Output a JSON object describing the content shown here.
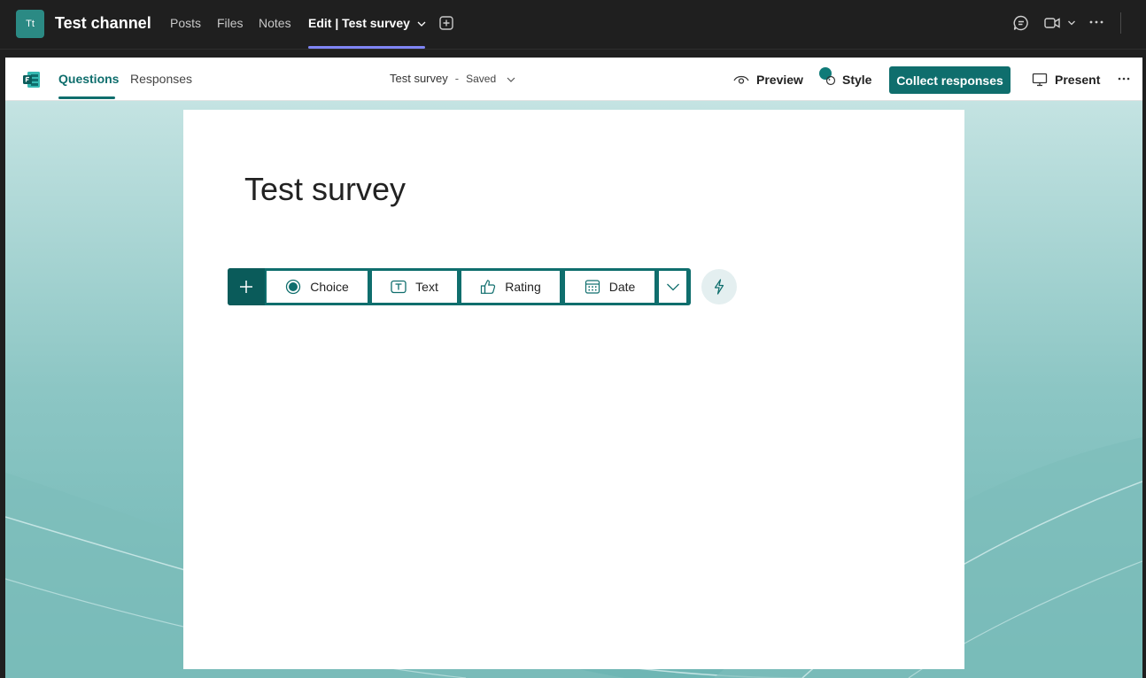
{
  "teams": {
    "avatar_text": "Tt",
    "channel_name": "Test channel",
    "tabs": [
      {
        "label": "Posts"
      },
      {
        "label": "Files"
      },
      {
        "label": "Notes"
      },
      {
        "label": "Edit | Test survey"
      }
    ],
    "accent_color": "#7f85f5",
    "icons": [
      "add-tab-icon",
      "chat-icon",
      "video-call-icon",
      "chevron-down-icon",
      "more-options-icon"
    ]
  },
  "forms": {
    "tabs": [
      {
        "label": "Questions"
      },
      {
        "label": "Responses"
      }
    ],
    "doc_title": "Test survey",
    "separator": "-",
    "save_status": "Saved",
    "actions": {
      "preview": "Preview",
      "style": "Style",
      "collect": "Collect responses",
      "present": "Present"
    },
    "brand_color": "#0f6e6d"
  },
  "survey": {
    "title": "Test survey",
    "question_types": [
      {
        "label": "Choice",
        "icon": "radio-choice-icon"
      },
      {
        "label": "Text",
        "icon": "text-box-icon"
      },
      {
        "label": "Rating",
        "icon": "thumbs-up-icon"
      },
      {
        "label": "Date",
        "icon": "calendar-icon"
      }
    ]
  }
}
